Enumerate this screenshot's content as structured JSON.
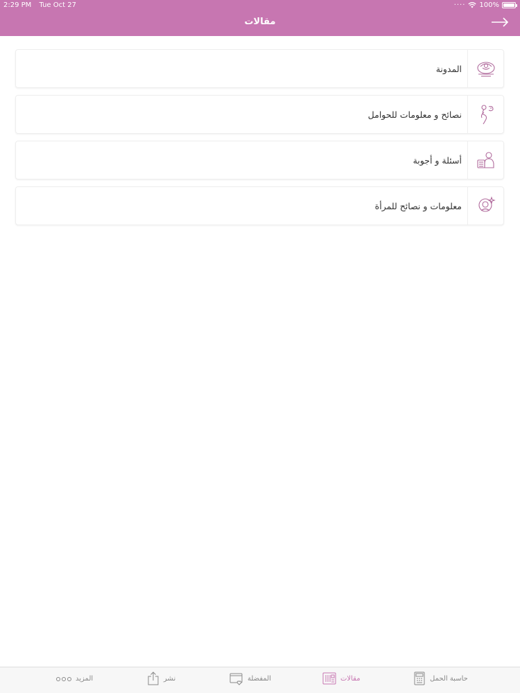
{
  "status_bar": {
    "time": "2:29 PM",
    "date": "Tue Oct 27",
    "battery": "100%",
    "battery_level": 1.0
  },
  "header": {
    "title": "مقالات",
    "back_icon": "arrow-right-icon"
  },
  "list": {
    "items": [
      {
        "label": "المدونة",
        "icon": "blog-icon"
      },
      {
        "label": "نصائح و معلومات للحوامل",
        "icon": "pregnant-icon"
      },
      {
        "label": "أسئلة و أجوبة",
        "icon": "qa-icon"
      },
      {
        "label": "معلومات و نصائح للمرأة",
        "icon": "woman-icon"
      }
    ]
  },
  "tab_bar": {
    "tabs": [
      {
        "label": "حاسبة الحمل",
        "icon": "calculator-icon",
        "active": false
      },
      {
        "label": "مقالات",
        "icon": "articles-icon",
        "active": true
      },
      {
        "label": "المفضلة",
        "icon": "favorites-icon",
        "active": false
      },
      {
        "label": "نشر",
        "icon": "share-icon",
        "active": false
      },
      {
        "label": "المزيد",
        "icon": "more-icon",
        "active": false
      }
    ]
  },
  "colors": {
    "primary": "#c776b1",
    "icon": "#b06a9c",
    "inactive": "#888888"
  }
}
